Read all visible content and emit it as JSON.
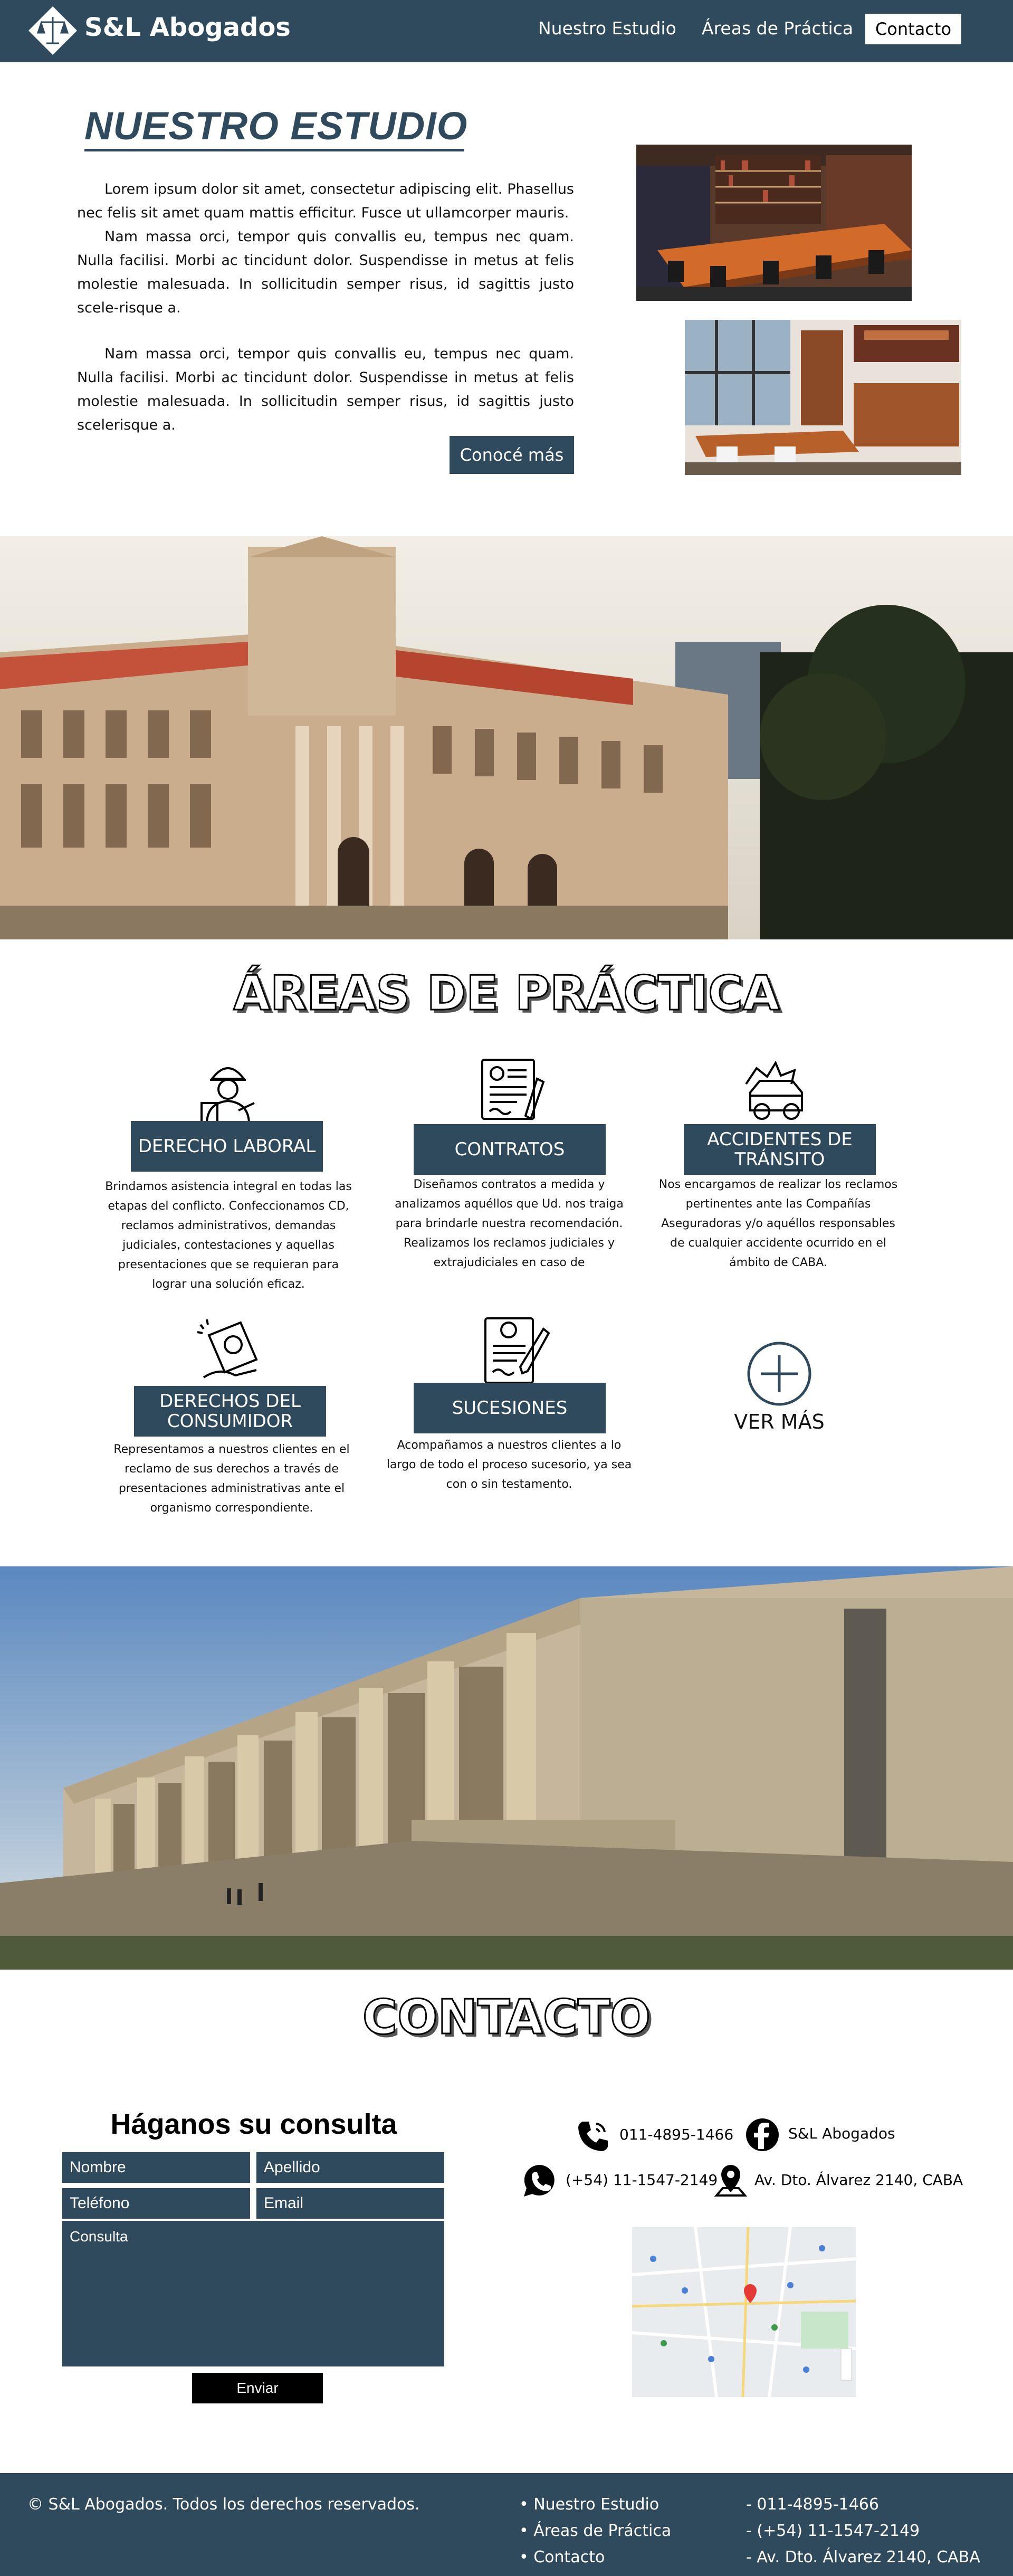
{
  "header": {
    "brand": "S&L Abogados",
    "nav": [
      "Nuestro Estudio",
      "Áreas de Práctica",
      "Contacto"
    ]
  },
  "estudio": {
    "title": "NUESTRO ESTUDIO",
    "p1": "Lorem ipsum dolor sit amet, consectetur adipiscing elit. Phasellus nec felis sit amet quam mattis efficitur. Fusce ut ullamcorper mauris.",
    "p2": "Nam massa orci, tempor quis convallis eu, tempus nec quam. Nulla facilisi. Morbi ac tincidunt dolor. Suspendisse in metus at felis molestie malesuada. In sollicitudin semper risus, id sagittis justo scele-risque a.",
    "p3": "Nam massa orci, tempor quis convallis eu, tempus nec quam. Nulla facilisi. Morbi ac tincidunt dolor. Suspendisse in metus at felis molestie malesuada. In sollicitudin semper risus, id sagittis justo scelerisque a.",
    "cta": "Conocé más"
  },
  "areas": {
    "title": "ÁREAS DE PRÁCTICA",
    "items": [
      {
        "name": "DERECHO LABORAL",
        "desc": "Brindamos asistencia integral en todas las etapas del conflicto. Confeccionamos CD, reclamos administrativos, demandas judiciales, contestaciones y aquellas presentaciones que se requieran para lograr una solución eficaz.",
        "icon": "worker-icon"
      },
      {
        "name": "CONTRATOS",
        "desc": "Diseñamos contratos a medida y analizamos aquéllos que Ud. nos traiga para brindarle nuestra recomendación. Realizamos los reclamos judiciales y extrajudiciales en caso de",
        "icon": "contract-icon"
      },
      {
        "name": "ACCIDENTES DE TRÁNSITO",
        "desc": "Nos encargamos de realizar los reclamos pertinentes ante las Compañías Aseguradoras y/o aquéllos responsables de cualquier accidente ocurrido en el ámbito de CABA.",
        "icon": "car-crash-icon"
      },
      {
        "name": "DERECHOS DEL CONSUMIDOR",
        "desc": "Representamos a nuestros clientes en el reclamo de sus derechos a través de presentaciones administrativas ante el organismo correspondiente.",
        "icon": "consumer-icon"
      },
      {
        "name": "SUCESIONES",
        "desc": "Acompañamos a nuestros clientes a lo largo de todo el proceso sucesorio, ya sea con o sin testamento.",
        "icon": "testament-icon"
      }
    ],
    "ver_mas": "VER MÁS"
  },
  "contacto": {
    "title": "CONTACTO",
    "form_title": "Háganos su consulta",
    "fields": {
      "nombre": "Nombre",
      "apellido": "Apellido",
      "telefono": "Teléfono",
      "email": "Email",
      "consulta": "Consulta"
    },
    "send": "Enviar",
    "phone": "011-4895-1466",
    "facebook": "S&L Abogados",
    "whatsapp": "(+54) 11-1547-2149",
    "address": "Av. Dto. Álvarez 2140, CABA"
  },
  "footer": {
    "copyright": "© S&L Abogados. Todos los derechos reservados.",
    "links": [
      "• Nuestro Estudio",
      "• Áreas de Práctica",
      "• Contacto"
    ],
    "info": [
      "- 011-4895-1466",
      "- (+54) 11-1547-2149",
      "- Av. Dto. Álvarez 2140, CABA"
    ]
  },
  "colors": {
    "primary": "#2e4a5c",
    "white": "#ffffff"
  }
}
